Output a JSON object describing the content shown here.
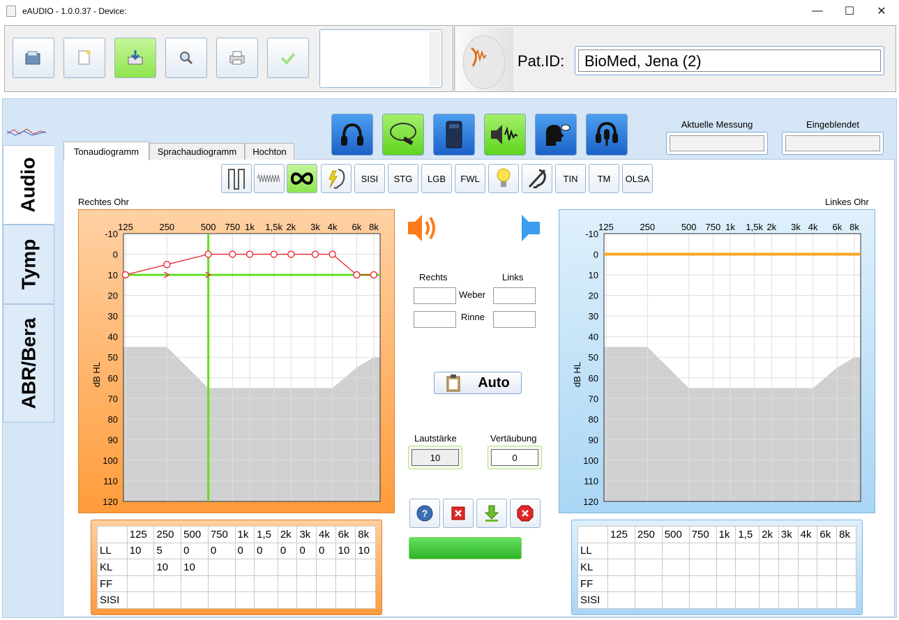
{
  "window": {
    "title": "eAUDIO - 1.0.0.37 - Device:",
    "minimize": "—",
    "maximize": "☐",
    "close": "✕"
  },
  "patient": {
    "label": "Pat.ID:",
    "value": "BioMed, Jena (2)"
  },
  "side_tabs": [
    "Audio",
    "Tymp",
    "ABR/Bera"
  ],
  "tabs": [
    "Tonaudiogramm",
    "Sprachaudiogramm",
    "Hochton"
  ],
  "measurement": {
    "current_label": "Aktuelle Messung",
    "shown_label": "Eingeblendet"
  },
  "test_buttons": [
    "SISI",
    "STG",
    "LGB",
    "FWL",
    "TIN",
    "TM",
    "OLSA"
  ],
  "ears": {
    "right": "Rechtes Ohr",
    "left": "Linkes Ohr"
  },
  "weber_rinne": {
    "right": "Rechts",
    "left": "Links",
    "weber": "Weber",
    "rinne": "Rinne"
  },
  "auto_label": "Auto",
  "volume": {
    "label": "Lautstärke",
    "value": "10"
  },
  "masking": {
    "label": "Vertäubung",
    "value": "0"
  },
  "colors": {
    "right_ear": "#ff8c00",
    "left_ear": "#4aa3f0",
    "air": "#e8202a",
    "marker": "#66dd22",
    "left_line": "#f5a623"
  },
  "chart_data": [
    {
      "type": "line",
      "title": "Rechtes Ohr",
      "ylabel": "dB HL",
      "x": [
        "125",
        "250",
        "500",
        "750",
        "1k",
        "1,5k",
        "2k",
        "3k",
        "4k",
        "6k",
        "8k"
      ],
      "xticks": [
        "125",
        "250",
        "500",
        "750",
        "1k",
        "1,5k",
        "2k",
        "3k",
        "4k",
        "6k",
        "8k"
      ],
      "yticks": [
        "-10",
        "0",
        "10",
        "20",
        "30",
        "40",
        "50",
        "60",
        "70",
        "80",
        "90",
        "100",
        "110",
        "120"
      ],
      "ylim": [
        -10,
        120
      ],
      "y_inverted": true,
      "grid": true,
      "series": [
        {
          "values": [
            10,
            5,
            0,
            0,
            0,
            0,
            0,
            0,
            0,
            10,
            10
          ]
        },
        {
          "values": [
            null,
            10,
            10,
            null,
            null,
            null,
            null,
            null,
            null,
            null,
            null
          ]
        }
      ],
      "markers": {
        "horizontal_db": 10,
        "vertical_freq": "500"
      },
      "shaded_region_db": [
        45,
        45,
        65,
        65,
        65,
        65,
        65,
        65,
        65,
        55,
        50
      ]
    },
    {
      "type": "line",
      "title": "Linkes Ohr",
      "ylabel": "dB HL",
      "xticks": [
        "125",
        "250",
        "500",
        "750",
        "1k",
        "1,5k",
        "2k",
        "3k",
        "4k",
        "6k",
        "8k"
      ],
      "yticks": [
        "-10",
        "0",
        "10",
        "20",
        "30",
        "40",
        "50",
        "60",
        "70",
        "80",
        "90",
        "100",
        "110",
        "120"
      ],
      "ylim": [
        -10,
        120
      ],
      "y_inverted": true,
      "grid": true,
      "series": [],
      "markers": {
        "horizontal_db": 0
      },
      "shaded_region_db": [
        45,
        45,
        65,
        65,
        65,
        65,
        65,
        65,
        65,
        55,
        50
      ]
    }
  ],
  "table": {
    "columns": [
      "",
      "125",
      "250",
      "500",
      "750",
      "1k",
      "1,5",
      "2k",
      "3k",
      "4k",
      "6k",
      "8k"
    ],
    "rows_right": [
      [
        "LL",
        "10",
        "5",
        "0",
        "0",
        "0",
        "0",
        "0",
        "0",
        "0",
        "10",
        "10"
      ],
      [
        "KL",
        "",
        "10",
        "10",
        "",
        "",
        "",
        "",
        "",
        "",
        "",
        ""
      ],
      [
        "FF",
        "",
        "",
        "",
        "",
        "",
        "",
        "",
        "",
        "",
        "",
        ""
      ],
      [
        "SISI",
        "",
        "",
        "",
        "",
        "",
        "",
        "",
        "",
        "",
        "",
        ""
      ]
    ],
    "rows_left": [
      [
        "LL",
        "",
        "",
        "",
        "",
        "",
        "",
        "",
        "",
        "",
        "",
        ""
      ],
      [
        "KL",
        "",
        "",
        "",
        "",
        "",
        "",
        "",
        "",
        "",
        "",
        ""
      ],
      [
        "FF",
        "",
        "",
        "",
        "",
        "",
        "",
        "",
        "",
        "",
        "",
        ""
      ],
      [
        "SISI",
        "",
        "",
        "",
        "",
        "",
        "",
        "",
        "",
        "",
        "",
        ""
      ]
    ]
  }
}
